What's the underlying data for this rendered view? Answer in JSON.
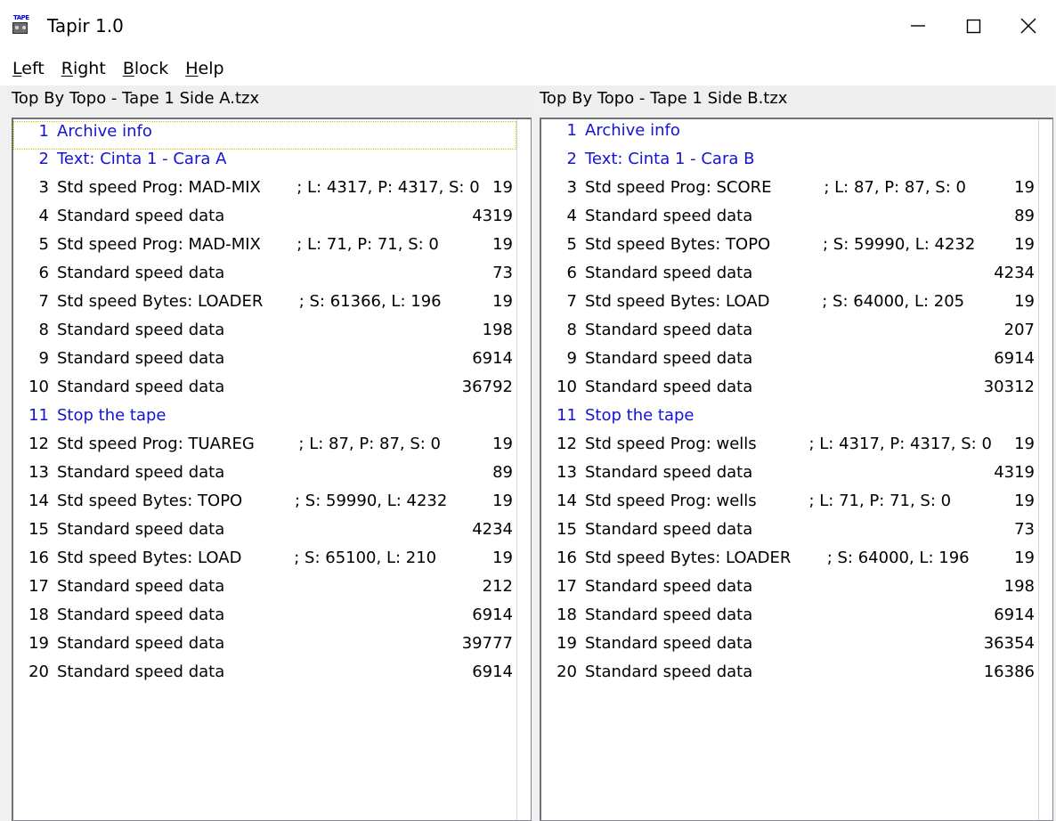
{
  "window": {
    "title": "Tapir 1.0",
    "icon": "cassette-tape-icon",
    "controls": {
      "minimize": "minimize-icon",
      "maximize": "maximize-icon",
      "close": "close-icon"
    }
  },
  "menubar": {
    "items": [
      {
        "mnemonic": "L",
        "rest": "eft",
        "label": "Left"
      },
      {
        "mnemonic": "R",
        "rest": "ight",
        "label": "Right"
      },
      {
        "mnemonic": "B",
        "rest": "lock",
        "label": "Block"
      },
      {
        "mnemonic": "H",
        "rest": "elp",
        "label": "Help"
      }
    ]
  },
  "colors": {
    "blue_text": "#1414d2",
    "focus_outline": "#d8c800",
    "panel_bg": "#f0f0f0",
    "list_bg": "#ffffff"
  },
  "panes": {
    "left": {
      "header": "Top By Topo - Tape 1 Side A.tzx",
      "focused_row_index": 0,
      "rows": [
        {
          "idx": "1",
          "label": "Archive info",
          "detail": "",
          "num": "",
          "blue": true,
          "focused": true
        },
        {
          "idx": "2",
          "label": "Text: Cinta 1 - Cara A",
          "detail": "",
          "num": "",
          "blue": true
        },
        {
          "idx": "3",
          "label": "Std speed Prog: MAD-MIX",
          "detail": "; L: 4317, P: 4317, S: 0",
          "num": "19"
        },
        {
          "idx": "4",
          "label": "Standard speed data",
          "detail": "",
          "num": "4319"
        },
        {
          "idx": "5",
          "label": "Std speed Prog: MAD-MIX",
          "detail": "; L: 71, P: 71, S: 0",
          "num": "19"
        },
        {
          "idx": "6",
          "label": "Standard speed data",
          "detail": "",
          "num": "73"
        },
        {
          "idx": "7",
          "label": "Std speed Bytes: LOADER",
          "detail": "; S: 61366, L: 196",
          "num": "19"
        },
        {
          "idx": "8",
          "label": "Standard speed data",
          "detail": "",
          "num": "198"
        },
        {
          "idx": "9",
          "label": "Standard speed data",
          "detail": "",
          "num": "6914"
        },
        {
          "idx": "10",
          "label": "Standard speed data",
          "detail": "",
          "num": "36792"
        },
        {
          "idx": "11",
          "label": "Stop the tape",
          "detail": "",
          "num": "",
          "blue": true
        },
        {
          "idx": "12",
          "label": "Std speed Prog: TUAREG",
          "detail": "; L: 87, P: 87, S: 0",
          "num": "19"
        },
        {
          "idx": "13",
          "label": "Standard speed data",
          "detail": "",
          "num": "89"
        },
        {
          "idx": "14",
          "label": "Std speed Bytes: TOPO",
          "detail": "; S: 59990, L: 4232",
          "num": "19"
        },
        {
          "idx": "15",
          "label": "Standard speed data",
          "detail": "",
          "num": "4234"
        },
        {
          "idx": "16",
          "label": "Std speed Bytes: LOAD",
          "detail": "; S: 65100, L: 210",
          "num": "19"
        },
        {
          "idx": "17",
          "label": "Standard speed data",
          "detail": "",
          "num": "212"
        },
        {
          "idx": "18",
          "label": "Standard speed data",
          "detail": "",
          "num": "6914"
        },
        {
          "idx": "19",
          "label": "Standard speed data",
          "detail": "",
          "num": "39777"
        },
        {
          "idx": "20",
          "label": "Standard speed data",
          "detail": "",
          "num": "6914"
        }
      ]
    },
    "right": {
      "header": "Top By Topo - Tape 1 Side B.tzx",
      "focused_row_index": -1,
      "rows": [
        {
          "idx": "1",
          "label": "Archive info",
          "detail": "",
          "num": "",
          "blue": true
        },
        {
          "idx": "2",
          "label": "Text: Cinta 1 - Cara B",
          "detail": "",
          "num": "",
          "blue": true
        },
        {
          "idx": "3",
          "label": "Std speed Prog: SCORE",
          "detail": "; L: 87, P: 87, S: 0",
          "num": "19"
        },
        {
          "idx": "4",
          "label": "Standard speed data",
          "detail": "",
          "num": "89"
        },
        {
          "idx": "5",
          "label": "Std speed Bytes: TOPO",
          "detail": "; S: 59990, L: 4232",
          "num": "19"
        },
        {
          "idx": "6",
          "label": "Standard speed data",
          "detail": "",
          "num": "4234"
        },
        {
          "idx": "7",
          "label": "Std speed Bytes: LOAD",
          "detail": "; S: 64000, L: 205",
          "num": "19"
        },
        {
          "idx": "8",
          "label": "Standard speed data",
          "detail": "",
          "num": "207"
        },
        {
          "idx": "9",
          "label": "Standard speed data",
          "detail": "",
          "num": "6914"
        },
        {
          "idx": "10",
          "label": "Standard speed data",
          "detail": "",
          "num": "30312"
        },
        {
          "idx": "11",
          "label": "Stop the tape",
          "detail": "",
          "num": "",
          "blue": true
        },
        {
          "idx": "12",
          "label": "Std speed Prog: wells",
          "detail": "; L: 4317, P: 4317, S: 0",
          "num": "19"
        },
        {
          "idx": "13",
          "label": "Standard speed data",
          "detail": "",
          "num": "4319"
        },
        {
          "idx": "14",
          "label": "Std speed Prog: wells",
          "detail": "; L: 71, P: 71, S: 0",
          "num": "19"
        },
        {
          "idx": "15",
          "label": "Standard speed data",
          "detail": "",
          "num": "73"
        },
        {
          "idx": "16",
          "label": "Std speed Bytes: LOADER",
          "detail": "; S: 64000, L: 196",
          "num": "19"
        },
        {
          "idx": "17",
          "label": "Standard speed data",
          "detail": "",
          "num": "198"
        },
        {
          "idx": "18",
          "label": "Standard speed data",
          "detail": "",
          "num": "6914"
        },
        {
          "idx": "19",
          "label": "Standard speed data",
          "detail": "",
          "num": "36354"
        },
        {
          "idx": "20",
          "label": "Standard speed data",
          "detail": "",
          "num": "16386"
        }
      ]
    }
  }
}
